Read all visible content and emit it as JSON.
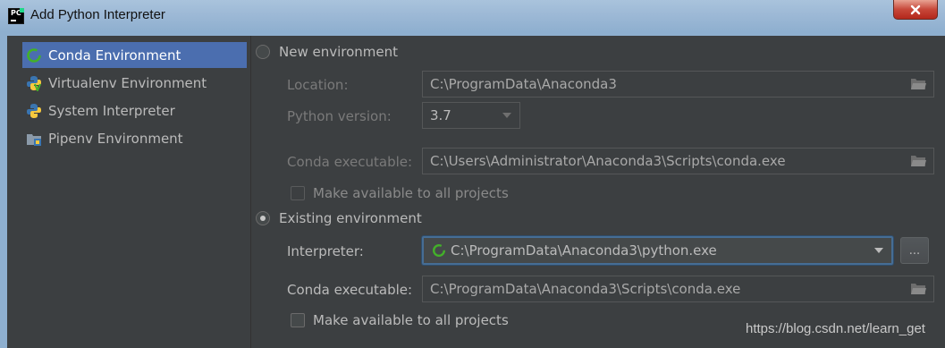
{
  "window": {
    "title": "Add Python Interpreter"
  },
  "sidebar": {
    "items": [
      {
        "label": "Conda Environment",
        "icon": "conda-icon",
        "selected": true
      },
      {
        "label": "Virtualenv Environment",
        "icon": "virtualenv-icon",
        "selected": false
      },
      {
        "label": "System Interpreter",
        "icon": "python-icon",
        "selected": false
      },
      {
        "label": "Pipenv Environment",
        "icon": "pipenv-icon",
        "selected": false
      }
    ]
  },
  "new_env": {
    "radio_label": "New environment",
    "selected": false,
    "location_label": "Location:",
    "location_value": "C:\\ProgramData\\Anaconda3",
    "python_version_label": "Python version:",
    "python_version_value": "3.7",
    "conda_exec_label": "Conda executable:",
    "conda_exec_value": "C:\\Users\\Administrator\\Anaconda3\\Scripts\\conda.exe",
    "make_available_label": "Make available to all projects",
    "make_available_checked": false
  },
  "existing_env": {
    "radio_label": "Existing environment",
    "selected": true,
    "interpreter_label": "Interpreter:",
    "interpreter_value": "C:\\ProgramData\\Anaconda3\\python.exe",
    "browse_label": "...",
    "conda_exec_label": "Conda executable:",
    "conda_exec_value": "C:\\ProgramData\\Anaconda3\\Scripts\\conda.exe",
    "make_available_label": "Make available to all projects",
    "make_available_checked": false
  },
  "watermark": "https://blog.csdn.net/learn_get",
  "colors": {
    "background": "#3c3f41",
    "selection": "#4b6eaf",
    "focus_border": "#466d94",
    "text": "#bbbbbb",
    "conda_green": "#43b02a",
    "title_bar": "#9db9d6",
    "close_red": "#c7483a"
  }
}
